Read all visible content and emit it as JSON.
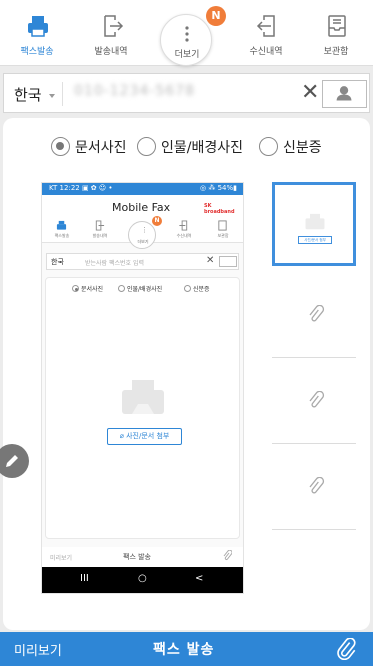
{
  "tabs": [
    {
      "label": "팩스발송",
      "icon": "fax-icon",
      "active": true
    },
    {
      "label": "발송내역",
      "icon": "sent-history-icon",
      "active": false
    },
    {
      "label": "더보기",
      "icon": "more-dots-icon",
      "active": false
    },
    {
      "label": "수신내역",
      "icon": "received-history-icon",
      "active": false
    },
    {
      "label": "보관함",
      "icon": "archive-icon",
      "active": false
    }
  ],
  "notification_badge": "N",
  "recipient": {
    "country": "한국",
    "phone_value": "010-1234-5678"
  },
  "doc_types": [
    {
      "label": "문서사진",
      "selected": true
    },
    {
      "label": "인물/배경사진",
      "selected": false
    },
    {
      "label": "신분증",
      "selected": false
    }
  ],
  "guide": {
    "status_left": "KT 12:22 ▣ ✿ ☺ •",
    "status_right": "◎ ⁂ 54%▮",
    "app_title": "Mobile Fax",
    "brand": "SK broadband",
    "tabs": [
      "팩스발송",
      "발송내역",
      "더보기",
      "수신내역",
      "보관함"
    ],
    "badge": "N",
    "country": "한국",
    "placeholder": "받는사람 팩스번호 입력",
    "doc_types": [
      "문서사진",
      "인물/배경사진",
      "신분증"
    ],
    "attach_button": "사진/문서 첨부",
    "bottom_preview": "미리보기",
    "bottom_send": "팩스 발송",
    "nav": [
      "III",
      "○",
      "<"
    ]
  },
  "thumb_attach_label": "사진/문서 첨부",
  "bottom": {
    "preview_label": "미리보기",
    "send_label": "팩스 발송"
  },
  "colors": {
    "accent": "#2e86d6",
    "badge": "#f07d3a",
    "thumb_border": "#3f8fdd"
  }
}
